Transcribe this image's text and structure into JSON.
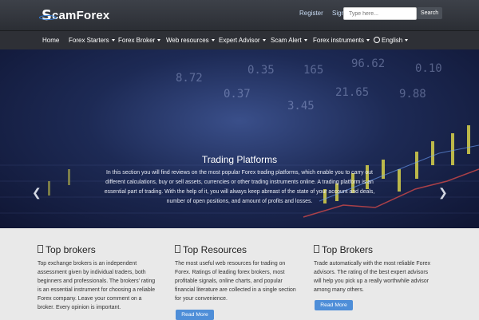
{
  "header": {
    "logo_prefix": "S",
    "logo_rest": "camForex",
    "links": [
      "Register",
      "Sign in"
    ],
    "search_placeholder": "Type here...",
    "search_button": "Search"
  },
  "nav": {
    "items": [
      {
        "label": "Home",
        "dropdown": false
      },
      {
        "label": "Forex Starters",
        "dropdown": true
      },
      {
        "label": "Forex Broker",
        "dropdown": true
      },
      {
        "label": "Web resources",
        "dropdown": true
      },
      {
        "label": "Expert Advisor",
        "dropdown": true
      },
      {
        "label": "Scam Alert",
        "dropdown": true
      },
      {
        "label": "Forex instruments",
        "dropdown": true
      },
      {
        "label": "English",
        "dropdown": true,
        "icon": "globe-icon"
      }
    ]
  },
  "hero": {
    "title": "Trading Platforms",
    "text": "In this section you will find reviews on the most popular Forex trading platforms, which enable you to carry out different calculations, buy or sell assets, currencies or other trading instruments online. A trading platform is an essential part of trading. With the help of it, you will always keep abreast of the state of your account and deals, number of open positions, and amount of profits and losses.",
    "prev_icon": "chevron-left-icon",
    "next_icon": "chevron-right-icon"
  },
  "columns": [
    {
      "title": "Top brokers",
      "text": "Top exchange brokers is an independent assessment given by individual traders, both beginners and professionals. The brokers' rating is an essential instrument for choosing a reliable Forex company. Leave your comment on a broker. Every opinion is important."
    },
    {
      "title": "Top Resources",
      "text": "The most useful web resources for trading on Forex. Ratings of leading forex brokers, most profitable signals, online charts, and popular financial literature are collected in a single section for your convenience.",
      "button": "Read More"
    },
    {
      "title": "Top Brokers",
      "text": "Trade automatically with the most reliable Forex advisors. The rating of the best expert advisors will help you pick up a really worthwhile advisor among many others.",
      "button": "Read More"
    }
  ]
}
